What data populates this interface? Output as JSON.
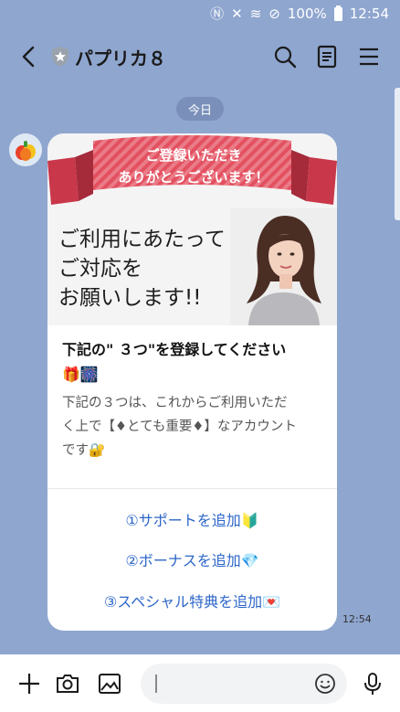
{
  "status_bar": {
    "battery_text": "100%",
    "time": "12:54",
    "icons": [
      "nfc-icon",
      "mute-icon",
      "wifi-icon",
      "do-not-disturb-icon",
      "battery-icon"
    ]
  },
  "header": {
    "title": "パプリカ８",
    "icons": [
      "back-icon",
      "shield-icon",
      "search-icon",
      "notes-icon",
      "menu-icon"
    ]
  },
  "chat": {
    "date_label": "今日",
    "message": {
      "ribbon_line1": "ご登録いただき",
      "ribbon_line2": "ありがとうございます！",
      "headline_line1": "ご利用にあたって",
      "headline_line2": "ご対応を",
      "headline_line3": "お願いします!!",
      "title_line1": "下記の\" ３つ\"を登録してください",
      "title_emojis": "🎁🎆",
      "body_line1": "下記の３つは、これからご利用いただ",
      "body_line2": "く上で【♦とても重要♦】なアカウント",
      "body_line3": "です🔐",
      "actions": [
        {
          "label": "①サポートを追加🔰"
        },
        {
          "label": "②ボーナスを追加💎"
        },
        {
          "label": "③スペシャル特典を追加💌"
        }
      ],
      "time": "12:54"
    }
  },
  "input_bar": {
    "placeholder": "",
    "icons": [
      "plus-icon",
      "camera-icon",
      "image-icon",
      "emoji-icon",
      "microphone-icon"
    ]
  },
  "colors": {
    "background": "#8fa6cf",
    "ribbon_red": "#e35060",
    "link_blue": "#2c66c8"
  }
}
